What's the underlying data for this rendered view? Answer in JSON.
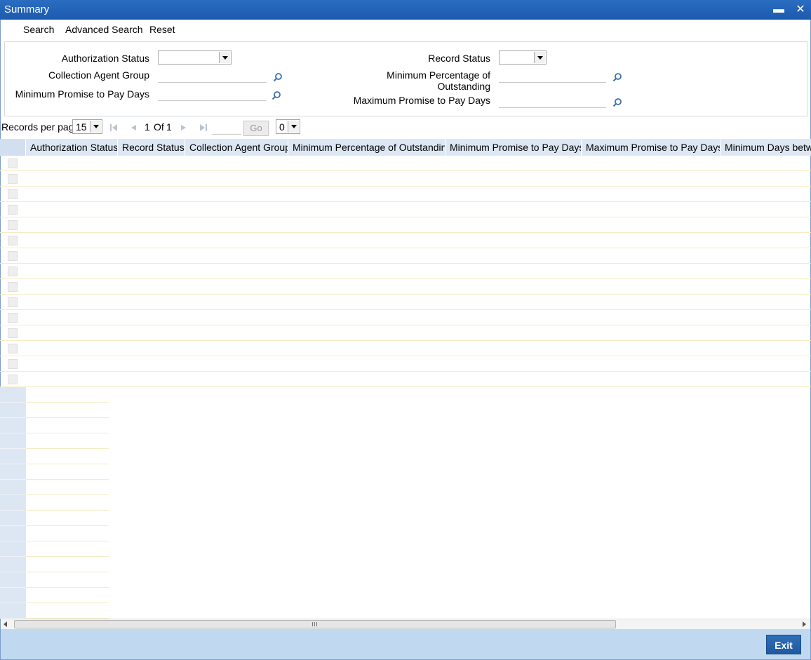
{
  "window": {
    "title": "Summary"
  },
  "menu": {
    "search": "Search",
    "advanced_search": "Advanced Search",
    "reset": "Reset"
  },
  "criteria": {
    "authorization_status_label": "Authorization Status",
    "authorization_status_value": "",
    "collection_agent_group_label": "Collection Agent Group",
    "collection_agent_group_value": "",
    "min_promise_to_pay_days_label": "Minimum Promise to Pay Days",
    "min_promise_to_pay_days_value": "",
    "record_status_label": "Record Status",
    "record_status_value": "",
    "min_pct_outstanding_label_line1": "Minimum Percentage of",
    "min_pct_outstanding_label_line2": "Outstanding",
    "min_pct_outstanding_value": "",
    "max_promise_to_pay_days_label": "Maximum Promise to Pay Days",
    "max_promise_to_pay_days_value": ""
  },
  "pager": {
    "records_per_page_label": "Records per page",
    "records_per_page_value": "15",
    "current_page": "1",
    "of_label": "Of",
    "total_pages": "1",
    "goto_value": "",
    "go_label": "Go",
    "extra_select_value": "0"
  },
  "grid": {
    "columns": [
      "Authorization Status",
      "Record Status",
      "Collection Agent Group",
      "Minimum Percentage of Outstanding",
      "Minimum Promise to Pay Days",
      "Maximum Promise to Pay Days",
      "Minimum Days betwe"
    ],
    "empty_rows": 15
  },
  "footer": {
    "exit_label": "Exit"
  },
  "colors": {
    "titlebar": "#1c5aae",
    "header_bg": "#dde7f4",
    "footer_bg": "#c0d9f0",
    "accent": "#2f6fb8"
  }
}
